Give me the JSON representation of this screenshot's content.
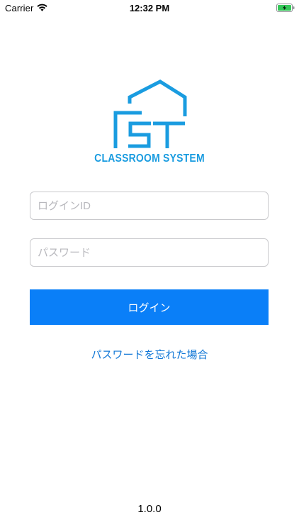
{
  "status_bar": {
    "carrier": "Carrier",
    "time": "12:32 PM",
    "wifi_icon": "wifi-icon",
    "battery_icon": "battery-charging-icon",
    "battery_color": "#35c759"
  },
  "logo": {
    "caption": "CLASSROOM SYSTEM",
    "color": "#1a9ce0"
  },
  "form": {
    "login_id_placeholder": "ログインID",
    "login_id_value": "",
    "password_placeholder": "パスワード",
    "password_value": "",
    "login_button_label": "ログイン",
    "login_button_color": "#0a7ff8",
    "forgot_password_label": "パスワードを忘れた場合",
    "link_color": "#1177d6"
  },
  "footer": {
    "version": "1.0.0"
  }
}
